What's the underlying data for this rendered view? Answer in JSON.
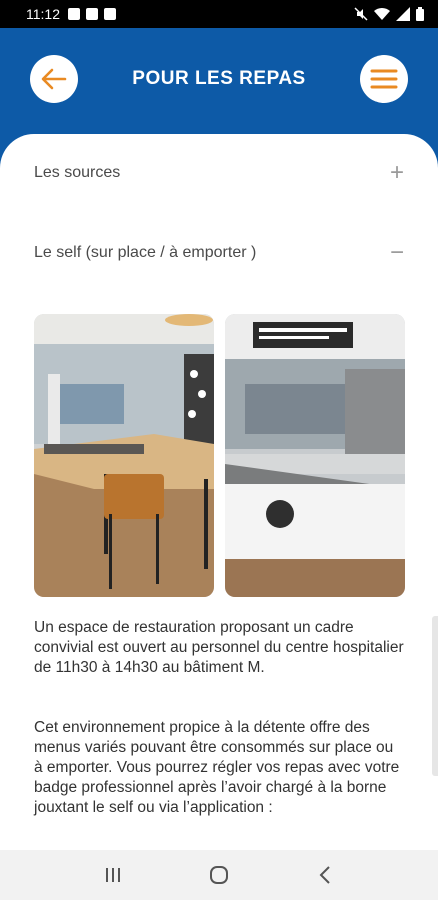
{
  "status_bar": {
    "time": "11:12",
    "left_icons": [
      "notification-icon",
      "image-icon",
      "app-icon"
    ],
    "right_icons": [
      "mute-icon",
      "wifi-icon",
      "signal-icon",
      "battery-icon"
    ]
  },
  "header": {
    "title": "POUR LES REPAS",
    "back_icon": "arrow-left-icon",
    "menu_icon": "hamburger-icon",
    "accent_color": "#e98a22",
    "background_color": "#0d5aa7"
  },
  "accordion": [
    {
      "label": "Les sources",
      "sign": "+",
      "expanded": false
    },
    {
      "label": "Le self (sur place / à emporter )",
      "sign": "−",
      "expanded": true
    }
  ],
  "photos": [
    {
      "name": "cafeteria-seating-photo"
    },
    {
      "name": "self-service-counter-photo"
    }
  ],
  "paragraphs": [
    "Un espace de restauration proposant un cadre convivial est ouvert au personnel du centre hospitalier de 11h30 à 14h30 au bâtiment M.",
    "Cet environnement propice à la détente offre des menus variés pouvant être consommés sur place ou à emporter. Vous pourrez régler vos repas avec votre badge professionnel après l’avoir chargé à la borne jouxtant le self ou via l’application :"
  ],
  "navbar": {
    "items": [
      "recent-apps-icon",
      "home-icon",
      "back-icon"
    ]
  }
}
